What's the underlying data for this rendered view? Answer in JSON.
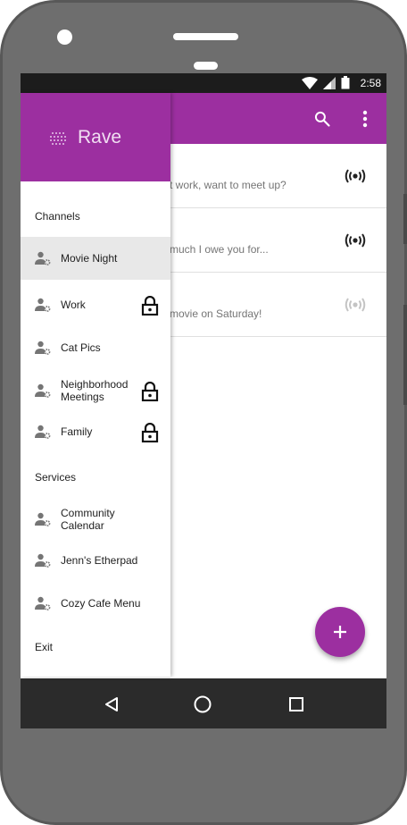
{
  "status_bar": {
    "time": "2:58"
  },
  "app": {
    "name": "Rave"
  },
  "conversations": [
    {
      "preview": "t work, want to meet up?",
      "broadcast_state": "active"
    },
    {
      "preview": "much I owe you for...",
      "broadcast_state": "active"
    },
    {
      "preview": "movie on Saturday!",
      "broadcast_state": "inactive"
    }
  ],
  "drawer": {
    "channels_title": "Channels",
    "channels": [
      {
        "label": "Movie Night",
        "locked": false,
        "active": true
      },
      {
        "label": "Work",
        "locked": true,
        "active": false
      },
      {
        "label": "Cat Pics",
        "locked": false,
        "active": false
      },
      {
        "label": "Neighborhood Meetings",
        "locked": true,
        "active": false
      },
      {
        "label": "Family",
        "locked": true,
        "active": false
      }
    ],
    "services_title": "Services",
    "services": [
      {
        "label": "Community Calendar"
      },
      {
        "label": "Jenn's Etherpad"
      },
      {
        "label": "Cozy Cafe Menu"
      }
    ],
    "exit_label": "Exit"
  },
  "icons": {
    "search": "search-icon",
    "overflow": "more-vert-icon",
    "broadcast": "broadcast-icon",
    "lock": "lock-icon",
    "person": "person-settings-icon",
    "fab": "add-icon",
    "logo": "rave-logo-icon"
  },
  "colors": {
    "primary": "#9c2fa0",
    "active_item_bg": "#e8e8e8",
    "navbar": "#2b2b2b",
    "statusbar": "#1c1c1c"
  }
}
